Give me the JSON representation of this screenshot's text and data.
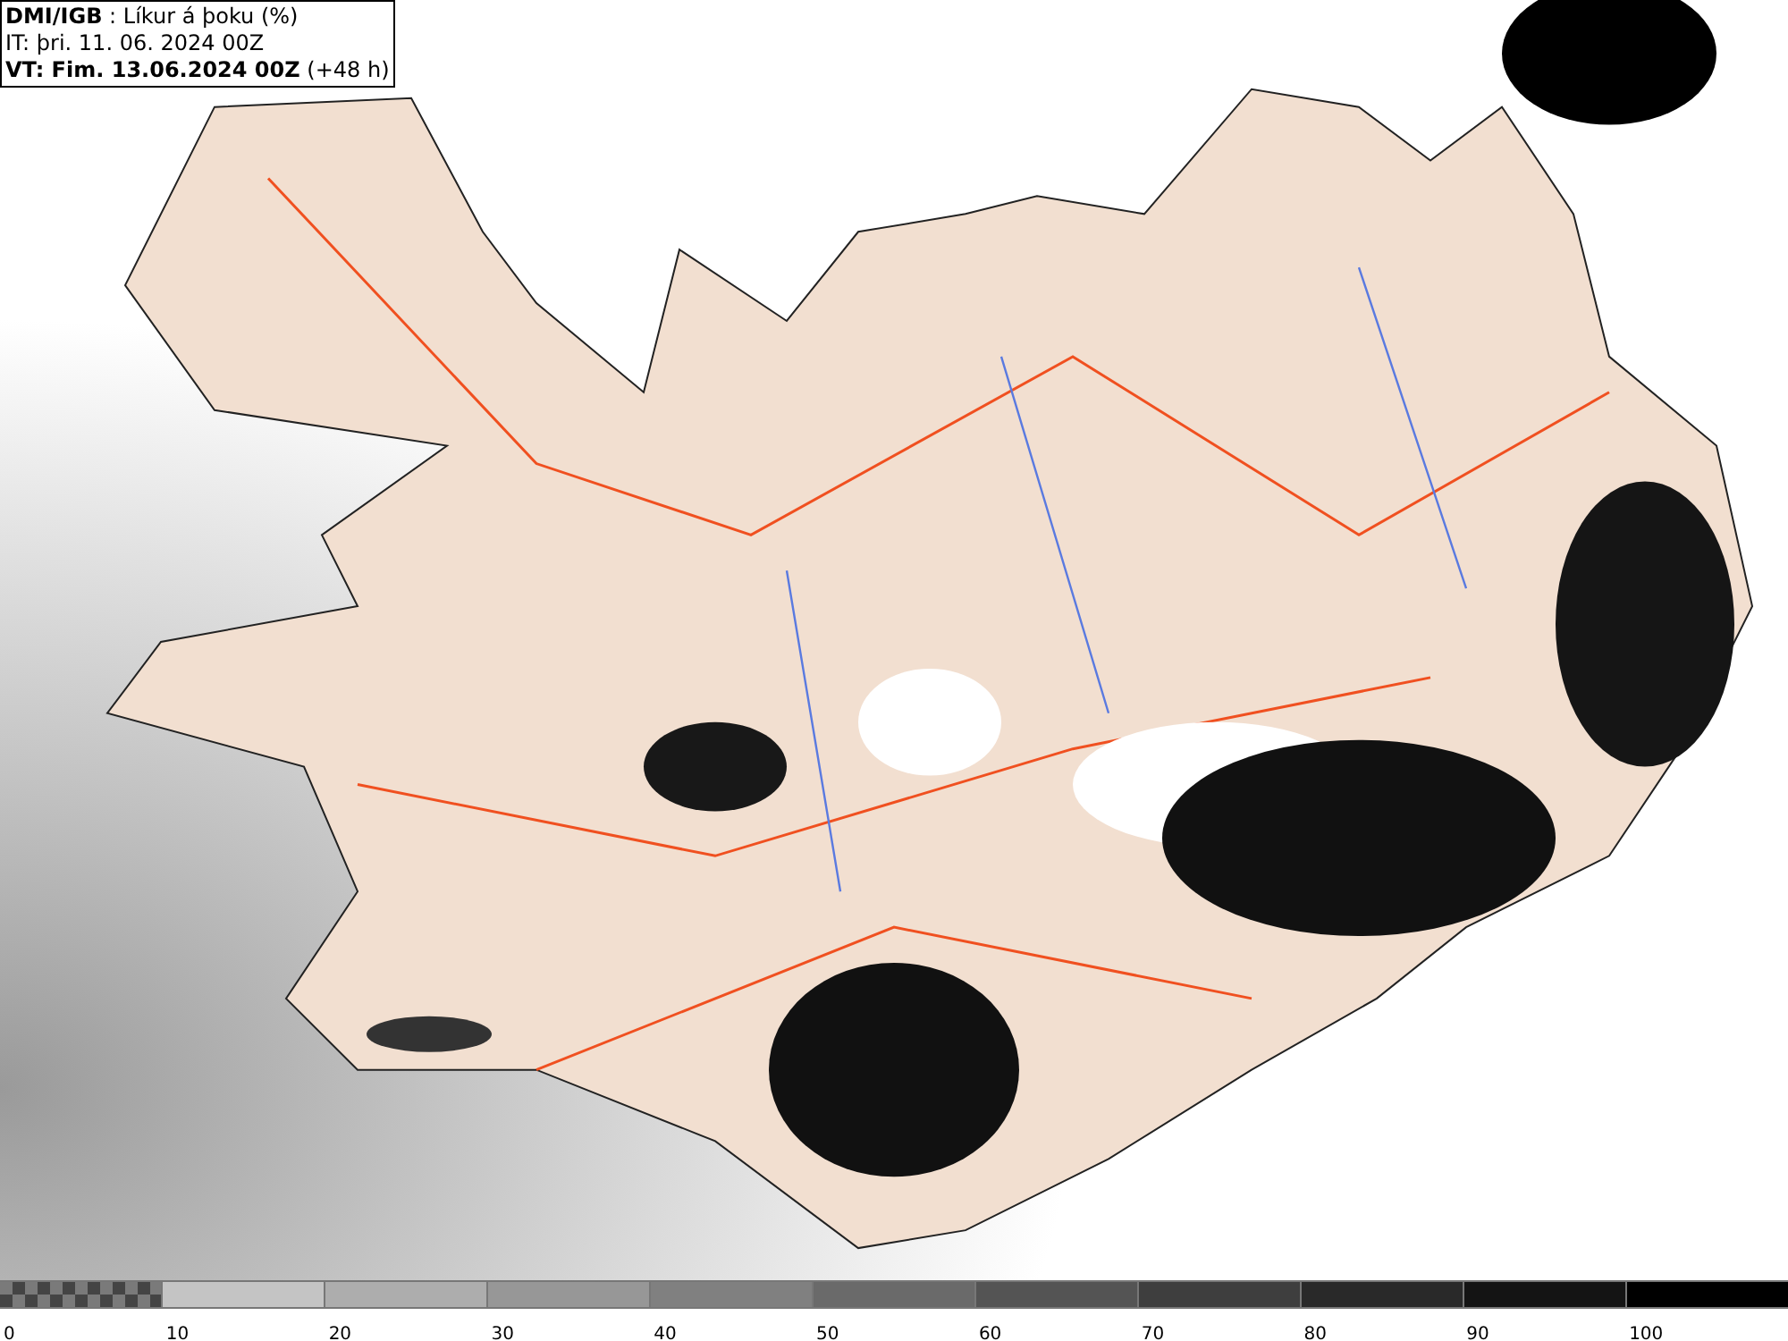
{
  "header": {
    "lines": [
      "**DMI/IGB** : Líkur á þoku (%)",
      "IT: þri. 11. 06. 2024 00Z",
      "**VT: Fim. 13.06.2024 00Z** (+48 h)"
    ]
  },
  "legend": {
    "segments": [
      {
        "kind": "checkered",
        "color": "#7a7a7a"
      },
      {
        "kind": "solid",
        "color": "#c4c4c4"
      },
      {
        "kind": "solid",
        "color": "#adadad"
      },
      {
        "kind": "solid",
        "color": "#979797"
      },
      {
        "kind": "solid",
        "color": "#808080"
      },
      {
        "kind": "solid",
        "color": "#6a6a6a"
      },
      {
        "kind": "solid",
        "color": "#545454"
      },
      {
        "kind": "solid",
        "color": "#3e3e3e"
      },
      {
        "kind": "solid",
        "color": "#292929"
      },
      {
        "kind": "solid",
        "color": "#141414"
      },
      {
        "kind": "solid",
        "color": "#000000"
      }
    ],
    "labels": [
      "0",
      "10",
      "20",
      "30",
      "40",
      "50",
      "60",
      "70",
      "80",
      "90",
      "100"
    ]
  }
}
